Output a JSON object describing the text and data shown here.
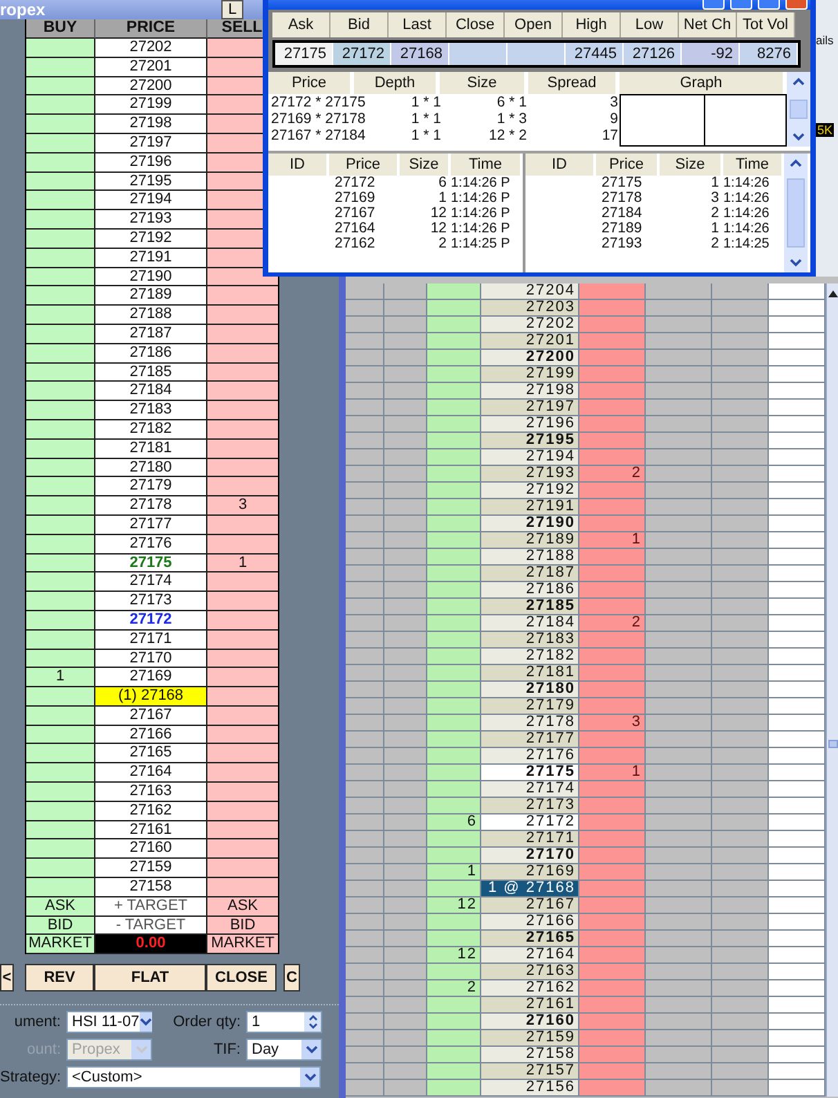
{
  "order_ladder": {
    "title": "ropex",
    "title_button": "L",
    "columns": [
      "BUY",
      "PRICE",
      "SELL"
    ],
    "rows": [
      {
        "price": "27202",
        "kind": "normal"
      },
      {
        "price": "27201",
        "kind": "normal"
      },
      {
        "price": "27200",
        "kind": "normal"
      },
      {
        "price": "27199",
        "kind": "normal"
      },
      {
        "price": "27198",
        "kind": "normal"
      },
      {
        "price": "27197",
        "kind": "normal"
      },
      {
        "price": "27196",
        "kind": "normal"
      },
      {
        "price": "27195",
        "kind": "normal"
      },
      {
        "price": "27194",
        "kind": "normal"
      },
      {
        "price": "27193",
        "kind": "normal"
      },
      {
        "price": "27192",
        "kind": "normal"
      },
      {
        "price": "27191",
        "kind": "normal"
      },
      {
        "price": "27190",
        "kind": "normal"
      },
      {
        "price": "27189",
        "kind": "normal"
      },
      {
        "price": "27188",
        "kind": "normal"
      },
      {
        "price": "27187",
        "kind": "normal"
      },
      {
        "price": "27186",
        "kind": "normal"
      },
      {
        "price": "27185",
        "kind": "normal"
      },
      {
        "price": "27184",
        "kind": "normal"
      },
      {
        "price": "27183",
        "kind": "normal"
      },
      {
        "price": "27182",
        "kind": "normal"
      },
      {
        "price": "27181",
        "kind": "normal"
      },
      {
        "price": "27180",
        "kind": "normal"
      },
      {
        "price": "27179",
        "kind": "normal"
      },
      {
        "price": "27178",
        "sell": "3",
        "kind": "normal"
      },
      {
        "price": "27177",
        "kind": "normal"
      },
      {
        "price": "27176",
        "kind": "normal"
      },
      {
        "price": "27175",
        "sell": "1",
        "kind": "ask"
      },
      {
        "price": "27174",
        "kind": "normal"
      },
      {
        "price": "27173",
        "kind": "normal"
      },
      {
        "price": "27172",
        "kind": "bid"
      },
      {
        "price": "27171",
        "kind": "normal"
      },
      {
        "price": "27170",
        "kind": "normal"
      },
      {
        "price": "27169",
        "buy": "1",
        "kind": "normal"
      },
      {
        "price": "(1) 27168",
        "kind": "last"
      },
      {
        "price": "27167",
        "kind": "normal"
      },
      {
        "price": "27166",
        "kind": "normal"
      },
      {
        "price": "27165",
        "kind": "normal"
      },
      {
        "price": "27164",
        "kind": "normal"
      },
      {
        "price": "27163",
        "kind": "normal"
      },
      {
        "price": "27162",
        "kind": "normal"
      },
      {
        "price": "27161",
        "kind": "normal"
      },
      {
        "price": "27160",
        "kind": "normal"
      },
      {
        "price": "27159",
        "kind": "normal"
      },
      {
        "price": "27158",
        "kind": "normal"
      }
    ],
    "footer_rows": [
      {
        "left": "ASK",
        "center": "+ TARGET",
        "right": "ASK",
        "kind": "target"
      },
      {
        "left": "BID",
        "center": "- TARGET",
        "right": "BID",
        "kind": "target"
      },
      {
        "left": "MARKET",
        "center": "0.00",
        "right": "MARKET",
        "kind": "pnl"
      }
    ],
    "buttons": [
      "<",
      "REV",
      "FLAT",
      "CLOSE",
      "C"
    ]
  },
  "order_form": {
    "instrument_label": "ument:",
    "instrument": "HSI 11-07",
    "qty_label": "Order qty:",
    "qty": "1",
    "account_label": "ount:",
    "account": "Propex",
    "account_disabled": true,
    "tif_label": "TIF:",
    "tif": "Day",
    "strategy_label": "Strategy:",
    "strategy": "<Custom>"
  },
  "level2": {
    "quote": [
      {
        "label": "Ask",
        "value": "27175"
      },
      {
        "label": "Bid",
        "value": "27172"
      },
      {
        "label": "Last",
        "value": "27168"
      },
      {
        "label": "Close"
      },
      {
        "label": "Open"
      },
      {
        "label": "High",
        "value": "27445"
      },
      {
        "label": "Low",
        "value": "27126"
      },
      {
        "label": "Net Ch",
        "value": "-92"
      },
      {
        "label": "Tot Vol",
        "value": "8276"
      }
    ],
    "depth_columns": [
      "Price",
      "Depth",
      "Size",
      "Spread",
      "Graph"
    ],
    "depth_rows": [
      {
        "price": "27172 * 27175",
        "depth": "1 * 1",
        "size": "6 * 1",
        "spread": "3"
      },
      {
        "price": "27169 * 27178",
        "depth": "1 * 1",
        "size": "1 * 3",
        "spread": "9"
      },
      {
        "price": "27167 * 27184",
        "depth": "1 * 1",
        "size": "12 * 2",
        "spread": "17"
      }
    ],
    "bid_trades": {
      "columns": [
        "ID",
        "Price",
        "Size",
        "Time"
      ],
      "rows": [
        {
          "price": "27172",
          "size": "6",
          "time": "1:14:26 P"
        },
        {
          "price": "27169",
          "size": "1",
          "time": "1:14:26 P"
        },
        {
          "price": "27167",
          "size": "12",
          "time": "1:14:26 P"
        },
        {
          "price": "27164",
          "size": "12",
          "time": "1:14:26 P"
        },
        {
          "price": "27162",
          "size": "2",
          "time": "1:14:25 P"
        }
      ]
    },
    "ask_trades": {
      "columns": [
        "ID",
        "Price",
        "Size",
        "Time"
      ],
      "rows": [
        {
          "price": "27175",
          "size": "1",
          "time": "1:14:26"
        },
        {
          "price": "27178",
          "size": "3",
          "time": "1:14:26"
        },
        {
          "price": "27184",
          "size": "2",
          "time": "1:14:26"
        },
        {
          "price": "27189",
          "size": "1",
          "time": "1:14:26"
        },
        {
          "price": "27193",
          "size": "2",
          "time": "1:14:25"
        }
      ]
    }
  },
  "background_window": {
    "label": "ails",
    "badge": "5K"
  },
  "price_ladder": {
    "rows": [
      {
        "price": "27204",
        "bold": false,
        "kind": "normal"
      },
      {
        "price": "27203",
        "bold": false,
        "kind": "normal"
      },
      {
        "price": "27202",
        "bold": false,
        "kind": "normal"
      },
      {
        "price": "27201",
        "bold": false,
        "kind": "normal"
      },
      {
        "price": "27200",
        "bold": true,
        "kind": "normal"
      },
      {
        "price": "27199",
        "bold": false,
        "kind": "normal"
      },
      {
        "price": "27198",
        "bold": false,
        "kind": "normal"
      },
      {
        "price": "27197",
        "bold": false,
        "kind": "normal"
      },
      {
        "price": "27196",
        "bold": false,
        "kind": "normal"
      },
      {
        "price": "27195",
        "bold": true,
        "kind": "normal"
      },
      {
        "price": "27194",
        "bold": false,
        "kind": "normal"
      },
      {
        "price": "27193",
        "ask": "2",
        "bold": false,
        "kind": "normal"
      },
      {
        "price": "27192",
        "bold": false,
        "kind": "normal"
      },
      {
        "price": "27191",
        "bold": false,
        "kind": "normal"
      },
      {
        "price": "27190",
        "bold": true,
        "kind": "normal"
      },
      {
        "price": "27189",
        "ask": "1",
        "bold": false,
        "kind": "normal"
      },
      {
        "price": "27188",
        "bold": false,
        "kind": "normal"
      },
      {
        "price": "27187",
        "bold": false,
        "kind": "normal"
      },
      {
        "price": "27186",
        "bold": false,
        "kind": "normal"
      },
      {
        "price": "27185",
        "bold": true,
        "kind": "normal"
      },
      {
        "price": "27184",
        "ask": "2",
        "bold": false,
        "kind": "normal"
      },
      {
        "price": "27183",
        "bold": false,
        "kind": "normal"
      },
      {
        "price": "27182",
        "bold": false,
        "kind": "normal"
      },
      {
        "price": "27181",
        "bold": false,
        "kind": "normal"
      },
      {
        "price": "27180",
        "bold": true,
        "kind": "normal"
      },
      {
        "price": "27179",
        "bold": false,
        "kind": "normal"
      },
      {
        "price": "27178",
        "ask": "3",
        "bold": false,
        "kind": "normal"
      },
      {
        "price": "27177",
        "bold": false,
        "kind": "normal"
      },
      {
        "price": "27176",
        "bold": false,
        "kind": "normal"
      },
      {
        "price": "27175",
        "ask": "1",
        "bold": true,
        "kind": "best"
      },
      {
        "price": "27174",
        "bold": false,
        "kind": "normal"
      },
      {
        "price": "27173",
        "bold": false,
        "kind": "normal"
      },
      {
        "price": "27172",
        "bid": "6",
        "bold": false,
        "kind": "best"
      },
      {
        "price": "27171",
        "bold": false,
        "kind": "normal"
      },
      {
        "price": "27170",
        "bold": true,
        "kind": "normal"
      },
      {
        "price": "27169",
        "bid": "1",
        "bold": false,
        "kind": "normal"
      },
      {
        "price": "1 @ 27168",
        "bold": false,
        "kind": "last"
      },
      {
        "price": "27167",
        "bid": "12",
        "bold": false,
        "kind": "normal"
      },
      {
        "price": "27166",
        "bold": false,
        "kind": "normal"
      },
      {
        "price": "27165",
        "bold": true,
        "kind": "normal"
      },
      {
        "price": "27164",
        "bid": "12",
        "bold": false,
        "kind": "normal"
      },
      {
        "price": "27163",
        "bold": false,
        "kind": "normal"
      },
      {
        "price": "27162",
        "bid": "2",
        "bold": false,
        "kind": "normal"
      },
      {
        "price": "27161",
        "bold": false,
        "kind": "normal"
      },
      {
        "price": "27160",
        "bold": true,
        "kind": "normal"
      },
      {
        "price": "27159",
        "bold": false,
        "kind": "normal"
      },
      {
        "price": "27158",
        "bold": false,
        "kind": "normal"
      },
      {
        "price": "27157",
        "bold": false,
        "kind": "normal"
      },
      {
        "price": "27156",
        "bold": false,
        "kind": "normal"
      }
    ]
  }
}
